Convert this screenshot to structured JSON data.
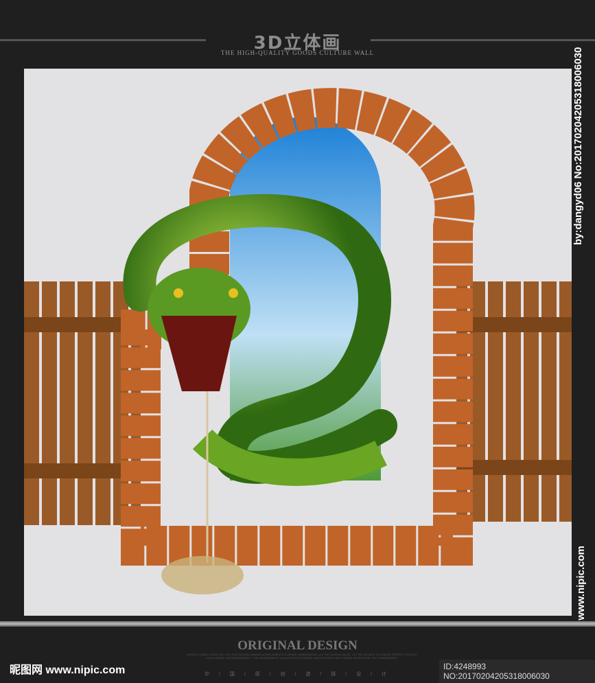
{
  "header": {
    "title": "3D立体画",
    "subtitle": "THE HIGH-QUALITY GOODS CULTURE WALL"
  },
  "footer": {
    "heading": "ORIGINAL DESIGN",
    "body": "DESIGN COMES FROM LIFE, LIFE FOR DESIGN CHANGE ACHIEVEMENTS IN SPACE HARMONIOUS, LET THE DESIGN VALUE, LET THE DETAILS TO CREATE PERFECT. PEOPLE CAN CHANGE THE ENVIRONMENT. THE ENVIRONMENT CAN AFFECT A PERSON, WHILE DESIGN CAN CHANGE PEOPLE AND THE ENVIRONMENT",
    "chars": "中 / 国 / 原 / 创 / 选 / 择 / 设 / 计"
  },
  "watermark": {
    "site": "昵图网 www.nipic.com",
    "id": "ID:4248993 NO:20170204205318006030",
    "side_top": "by:dangyd06 No:20170204205318006030",
    "side_bottom": "www.nipic.com"
  }
}
